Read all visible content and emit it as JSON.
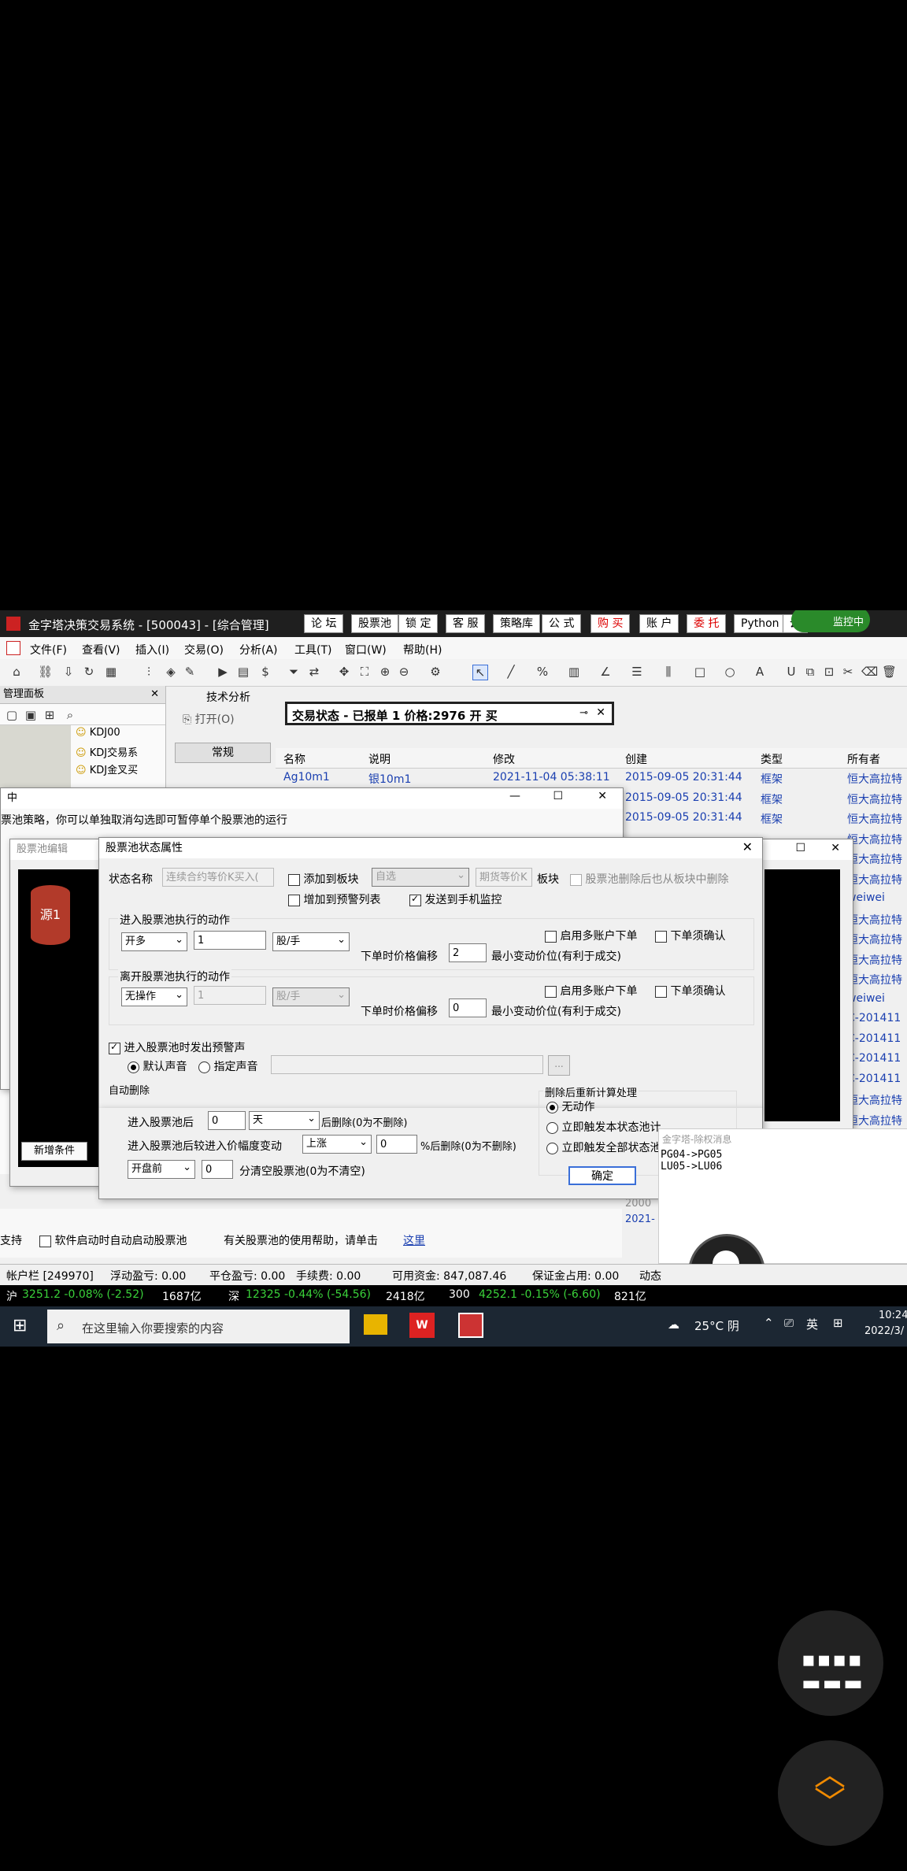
{
  "window": {
    "title": "金字塔决策交易系统 - [500043] - [综合管理]",
    "buttons": [
      "论 坛",
      "股票池",
      "锁 定",
      "客 服",
      "策略库",
      "公 式",
      "购 买",
      "账 户",
      "委 托",
      "Python",
      "云"
    ],
    "status_badge": "监控中"
  },
  "menu": [
    "文件(F)",
    "查看(V)",
    "插入(I)",
    "交易(O)",
    "分析(A)",
    "工具(T)",
    "窗口(W)",
    "帮助(H)"
  ],
  "panel": {
    "title": "管理面板",
    "items": [
      "KDJ00",
      "KDJ交易系",
      "KDJ金叉买"
    ]
  },
  "tabs": {
    "tech": "技术分析",
    "open": "打开(O)",
    "regular": "常规"
  },
  "trade_status": {
    "title": "交易状态 - 已报单 1 价格:2976 开 买"
  },
  "grid": {
    "headers": [
      "名称",
      "说明",
      "修改",
      "创建",
      "类型",
      "所有者"
    ],
    "rows": [
      {
        "name": "Ag10m1",
        "desc": "银10m1",
        "mod": "2021-11-04 05:38:11",
        "created": "2015-09-05 20:31:44",
        "type": "框架",
        "owner": "恒大高拉特"
      },
      {
        "name": "",
        "desc": "",
        "mod": "",
        "created": "2015-09-05 20:31:44",
        "type": "框架",
        "owner": "恒大高拉特"
      },
      {
        "name": "",
        "desc": "",
        "mod": "",
        "created": "2015-09-05 20:31:44",
        "type": "框架",
        "owner": "恒大高拉特"
      },
      {
        "name": "",
        "desc": "",
        "mod": "",
        "created": "",
        "type": "",
        "owner": "恒大高拉特"
      },
      {
        "name": "",
        "desc": "",
        "mod": "",
        "created": "",
        "type": "",
        "owner": "恒大高拉特"
      },
      {
        "name": "",
        "desc": "",
        "mod": "",
        "created": "",
        "type": "",
        "owner": "恒大高拉特"
      },
      {
        "name": "",
        "desc": "",
        "mod": "",
        "created": "",
        "type": "",
        "owner": "weiwei"
      },
      {
        "name": "",
        "desc": "",
        "mod": "",
        "created": "",
        "type": "",
        "owner": "恒大高拉特"
      },
      {
        "name": "",
        "desc": "",
        "mod": "",
        "created": "",
        "type": "",
        "owner": "恒大高拉特"
      },
      {
        "name": "",
        "desc": "",
        "mod": "",
        "created": "",
        "type": "",
        "owner": "恒大高拉特"
      },
      {
        "name": "",
        "desc": "",
        "mod": "",
        "created": "",
        "type": "",
        "owner": "恒大高拉特"
      },
      {
        "name": "",
        "desc": "",
        "mod": "",
        "created": "",
        "type": "",
        "owner": "weiwei"
      },
      {
        "name": "",
        "desc": "",
        "mod": "",
        "created": "",
        "type": "",
        "owner": "C-201411"
      },
      {
        "name": "",
        "desc": "",
        "mod": "",
        "created": "",
        "type": "",
        "owner": "C-201411"
      },
      {
        "name": "",
        "desc": "",
        "mod": "",
        "created": "",
        "type": "",
        "owner": "C-201411"
      },
      {
        "name": "",
        "desc": "",
        "mod": "",
        "created": "",
        "type": "",
        "owner": "C-201411"
      },
      {
        "name": "",
        "desc": "",
        "mod": "",
        "created": "",
        "type": "",
        "owner": "恒大高拉特"
      },
      {
        "name": "",
        "desc": "",
        "mod": "",
        "created": "",
        "type": "",
        "owner": "恒大高拉特"
      }
    ]
  },
  "bg_window": {
    "title": "中",
    "hint": "票池策略，你可以单独取消勾选即可暂停单个股票池的运行",
    "support": "支持",
    "autostart": "软件启动时自动启动股票池",
    "help": "有关股票池的使用帮助，请单击",
    "help_link": "这里",
    "year1": "2000",
    "year2": "2021-"
  },
  "editor": {
    "title": "股票池编辑",
    "node": "源1",
    "add_condition": "新增条件"
  },
  "dialog": {
    "title": "股票池状态属性",
    "state_name_label": "状态名称",
    "state_name_value": "连续合约等价K买入(",
    "add_to_board": "添加到板块",
    "board_select": "自选",
    "board_value": "期货等价K",
    "board_label": "板块",
    "delete_from_board": "股票池删除后也从板块中删除",
    "add_to_alert": "增加到预警列表",
    "send_mobile": "发送到手机监控",
    "enter_section": "进入股票池执行的动作",
    "enter_action": "开多",
    "enter_qty": "1",
    "enter_unit": "股/手",
    "multi_account": "启用多账户下单",
    "confirm_order": "下单须确认",
    "offset_label": "下单时价格偏移",
    "enter_offset": "2",
    "min_tick": "最小变动价位(有利于成交)",
    "leave_section": "离开股票池执行的动作",
    "leave_action": "无操作",
    "leave_qty": "1",
    "leave_unit": "股/手",
    "leave_offset": "0",
    "alert_sound": "进入股票池时发出预警声",
    "default_sound": "默认声音",
    "custom_sound": "指定声音",
    "browse": "...",
    "auto_delete": "自动删除",
    "after_enter": "进入股票池后",
    "days_value": "0",
    "days_unit": "天",
    "delete_after": "后删除(0为不删除)",
    "price_change": "进入股票池后较进入价幅度变动",
    "direction": "上涨",
    "pct_value": "0",
    "pct_delete": "%后删除(0为不删除)",
    "open_select": "开盘前",
    "minutes_value": "0",
    "clear_label": "分清空股票池(0为不清空)",
    "recalc_title": "删除后重新计算处理",
    "no_action": "无动作",
    "trigger_this": "立即触发本状态池计",
    "trigger_all": "立即触发全部状态池",
    "ok": "确定"
  },
  "popup": {
    "title": "金字塔-除权消息",
    "lines": [
      "PG04->PG05",
      "LU05->LU06"
    ]
  },
  "statusbar": {
    "account": "帐户栏 [249970]",
    "floating": "浮动盈亏: 0.00",
    "close_pl": "平仓盈亏: 0.00",
    "fee": "手续费: 0.00",
    "available": "可用资金: 847,087.46",
    "margin": "保证金占用: 0.00",
    "dyn": "动态"
  },
  "quotes": {
    "sh_label": "沪",
    "sh": "3251.2 -0.08% (-2.52)",
    "sh_vol": "1687亿",
    "sz_label": "深",
    "sz": "12325 -0.44% (-54.56)",
    "sz_vol": "2418亿",
    "hs_label": "300",
    "hs": "4252.1 -0.15% (-6.60)",
    "hs_vol": "821亿"
  },
  "taskbar": {
    "search": "在这里输入你要搜索的内容",
    "weather": "25°C 阴",
    "ime": "英",
    "time": "10:24",
    "date": "2022/3/"
  }
}
